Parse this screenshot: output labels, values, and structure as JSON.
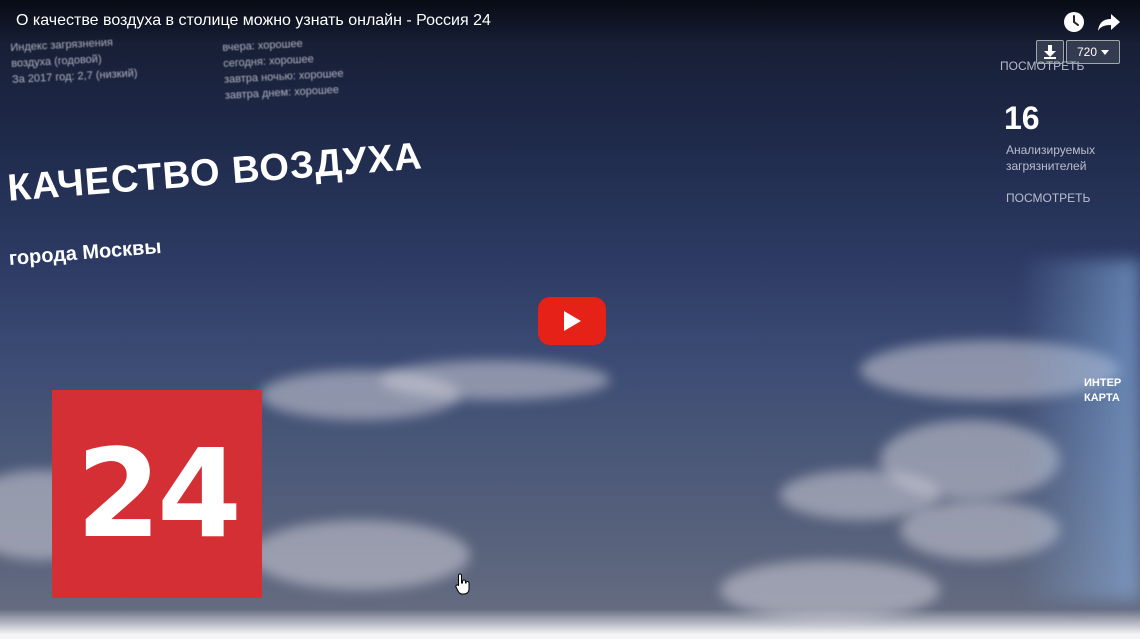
{
  "video": {
    "title": "О качестве воздуха в столице можно узнать онлайн - Россия 24",
    "quality": "720"
  },
  "graphic": {
    "headline": "КАЧЕСТВО ВОЗДУХА",
    "subheadline": "города Москвы",
    "stat_number": "16",
    "left_info": [
      "Индекс загрязнения",
      "воздуха (годовой)",
      "За 2017 год: 2,7 (низкий)"
    ],
    "mid_info": [
      "вчера: хорошее",
      "сегодня: хорошее",
      "завтра ночью: хорошее",
      "завтра днем: хорошее"
    ],
    "right_info": [
      "Анализируемых",
      "загрязнителей",
      "ПОСМОТРЕТЬ"
    ],
    "right_top_link": "ПОСМОТРЕТЬ",
    "map_label": [
      "ИНТЕР",
      "КАРТА"
    ]
  },
  "logo": {
    "text": "24",
    "color": "#d32f34"
  },
  "icons": {
    "watch_later": "clock-icon",
    "share": "share-arrow-icon",
    "download": "download-arrow-icon",
    "play": "play-icon",
    "cursor": "hand-pointer-icon"
  },
  "colors": {
    "play_button": "#e62117",
    "logo_bg": "#d32f34"
  }
}
